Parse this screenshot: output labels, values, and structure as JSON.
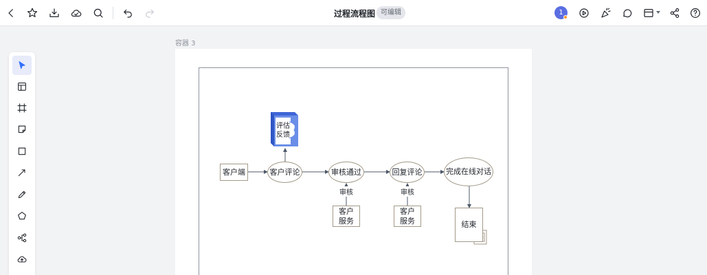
{
  "header": {
    "title": "过程流程图",
    "badge": "可编辑",
    "avatar_initial": "1"
  },
  "canvas": {
    "container_label": "容器 3"
  },
  "diagram": {
    "nodes": {
      "client": "客户端",
      "review": "客户评论",
      "approved": "审核通过",
      "reply": "回复评论",
      "complete": "完成在线对话",
      "service1": "客户服务",
      "service2": "客户服务",
      "end": "结束",
      "feedback_line1": "评估",
      "feedback_line2": "反馈"
    },
    "edge_labels": {
      "audit1": "审核",
      "audit2": "审核"
    }
  },
  "colors": {
    "accent": "#3370ff",
    "avatar": "#5b6ee1",
    "node_border": "#a39a88",
    "feedback_fill": "#6b8ee8"
  }
}
